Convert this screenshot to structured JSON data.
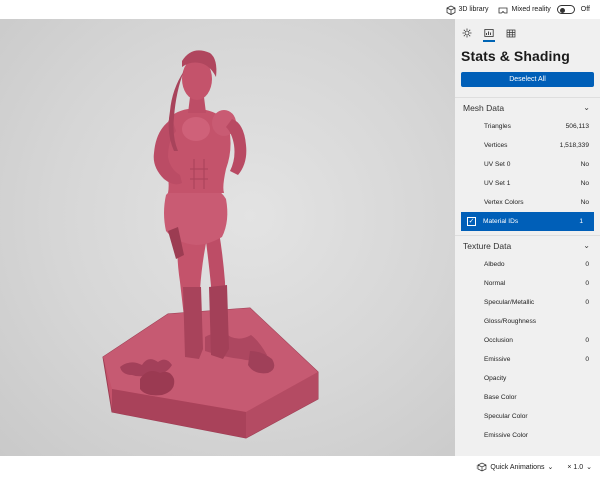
{
  "topbar": {
    "library_label": "3D library",
    "mixed_reality_label": "Mixed reality",
    "toggle_state_label": "Off"
  },
  "panel": {
    "title": "Stats & Shading",
    "deselect_label": "Deselect All",
    "mesh_section": {
      "title": "Mesh Data",
      "rows": [
        {
          "label": "Triangles",
          "value": "506,113"
        },
        {
          "label": "Vertices",
          "value": "1,518,339"
        },
        {
          "label": "UV Set 0",
          "value": "No"
        },
        {
          "label": "UV Set 1",
          "value": "No"
        },
        {
          "label": "Vertex Colors",
          "value": "No"
        }
      ],
      "selected_row": {
        "label": "Material IDs",
        "value": "1"
      }
    },
    "texture_section": {
      "title": "Texture Data",
      "rows": [
        {
          "label": "Albedo",
          "value": "0"
        },
        {
          "label": "Normal",
          "value": "0"
        },
        {
          "label": "Specular/Metallic",
          "value": "0"
        },
        {
          "label": "Gloss/Roughness",
          "value": ""
        },
        {
          "label": "Occlusion",
          "value": "0"
        },
        {
          "label": "Emissive",
          "value": "0"
        },
        {
          "label": "Opacity",
          "value": ""
        },
        {
          "label": "Base Color",
          "value": ""
        },
        {
          "label": "Specular Color",
          "value": ""
        },
        {
          "label": "Emissive Color",
          "value": ""
        }
      ]
    }
  },
  "bottombar": {
    "animations_label": "Quick Animations",
    "speed_label": "× 1.0"
  },
  "colors": {
    "accent": "#005fb8",
    "model": "#c4536b"
  },
  "icons": {
    "library": "cube-icon",
    "mixed_reality": "mixed-reality-icon",
    "lighting_tab": "sun-icon",
    "stats_tab": "stats-icon",
    "grid_tab": "grid-icon",
    "animations": "animation-icon"
  }
}
